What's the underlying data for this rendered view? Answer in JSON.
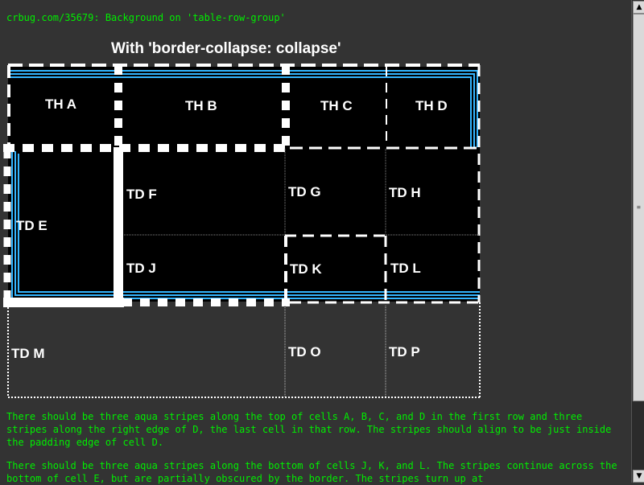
{
  "header": {
    "bug_link": "crbug.com/35679: Background on 'table-row-group'",
    "title": "With 'border-collapse: collapse'"
  },
  "cells": {
    "a": "TH A",
    "b": "TH B",
    "c": "TH C",
    "d": "TH D",
    "e": "TD E",
    "f": "TD F",
    "g": "TD G",
    "h": "TD H",
    "j": "TD J",
    "k": "TD K",
    "l": "TD L",
    "m": "TD M",
    "o": "TD O",
    "p": "TD P"
  },
  "paragraphs": {
    "p1": "There should be three aqua stripes along the top of cells A, B, C, and D in the first row and three stripes along the right edge of D, the last cell in that row. The stripes should align to be just inside the padding edge of cell D.",
    "p2": "There should be three aqua stripes along the bottom of cells J, K, and L. The stripes continue across the bottom of cell E, but are partially obscured by the border. The stripes turn up at"
  },
  "colors": {
    "background": "#333333",
    "text": "#00ee00",
    "stripe": "#33b5ff",
    "border": "#ffffff",
    "cell_bg": "#000000"
  },
  "scrollbar": {
    "up_icon": "arrow-up-icon",
    "down_icon": "arrow-down-icon"
  }
}
